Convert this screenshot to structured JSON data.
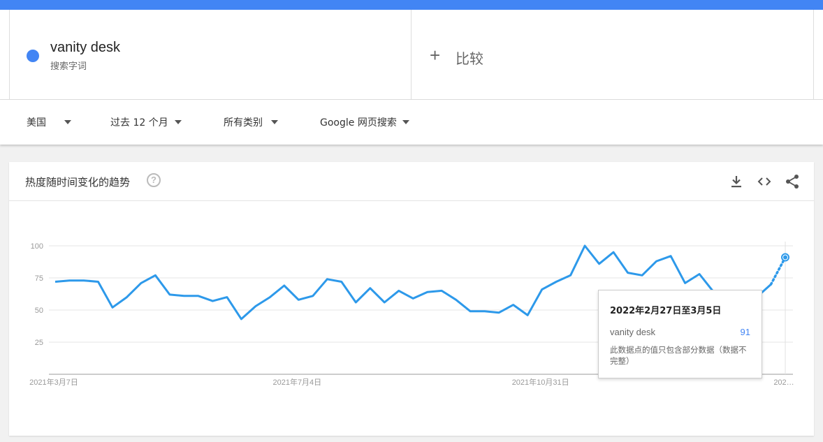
{
  "colors": {
    "accent": "#4285f4",
    "line": "#2d99ea"
  },
  "term": {
    "name": "vanity desk",
    "sub": "搜索字词"
  },
  "compare": {
    "icon": "plus-icon",
    "label": "比较"
  },
  "filters": {
    "region": "美国",
    "period": "过去 12 个月",
    "category": "所有类别",
    "source": "Google 网页搜索"
  },
  "card": {
    "title": "热度随时间变化的趋势",
    "help_icon": "help-icon",
    "help_glyph": "?",
    "tools": [
      "download-icon",
      "embed-icon",
      "share-icon"
    ]
  },
  "tooltip": {
    "date": "2022年2月27日至3月5日",
    "term": "vanity desk",
    "value": "91",
    "note": "此数据点的值只包含部分数据（数据不完整）"
  },
  "chart_data": {
    "type": "line",
    "y_ticks": [
      "100",
      "75",
      "50",
      "25"
    ],
    "ylim": [
      0,
      100
    ],
    "x_tick_labels": [
      {
        "index": 0,
        "label": "2021年3月7日"
      },
      {
        "index": 17,
        "label": "2021年7月4日"
      },
      {
        "index": 34,
        "label": "2021年10月31日"
      },
      {
        "index": 51,
        "label": "202…"
      }
    ],
    "series": [
      {
        "name": "vanity desk",
        "values": [
          72,
          73,
          73,
          72,
          52,
          60,
          71,
          77,
          62,
          61,
          61,
          57,
          60,
          43,
          53,
          60,
          69,
          58,
          61,
          74,
          72,
          56,
          67,
          56,
          65,
          59,
          64,
          65,
          58,
          49,
          49,
          48,
          54,
          46,
          66,
          72,
          77,
          100,
          86,
          95,
          79,
          77,
          88,
          92,
          71,
          78,
          64,
          60,
          60,
          60,
          70,
          91
        ],
        "partial_from_index": 50
      }
    ]
  }
}
